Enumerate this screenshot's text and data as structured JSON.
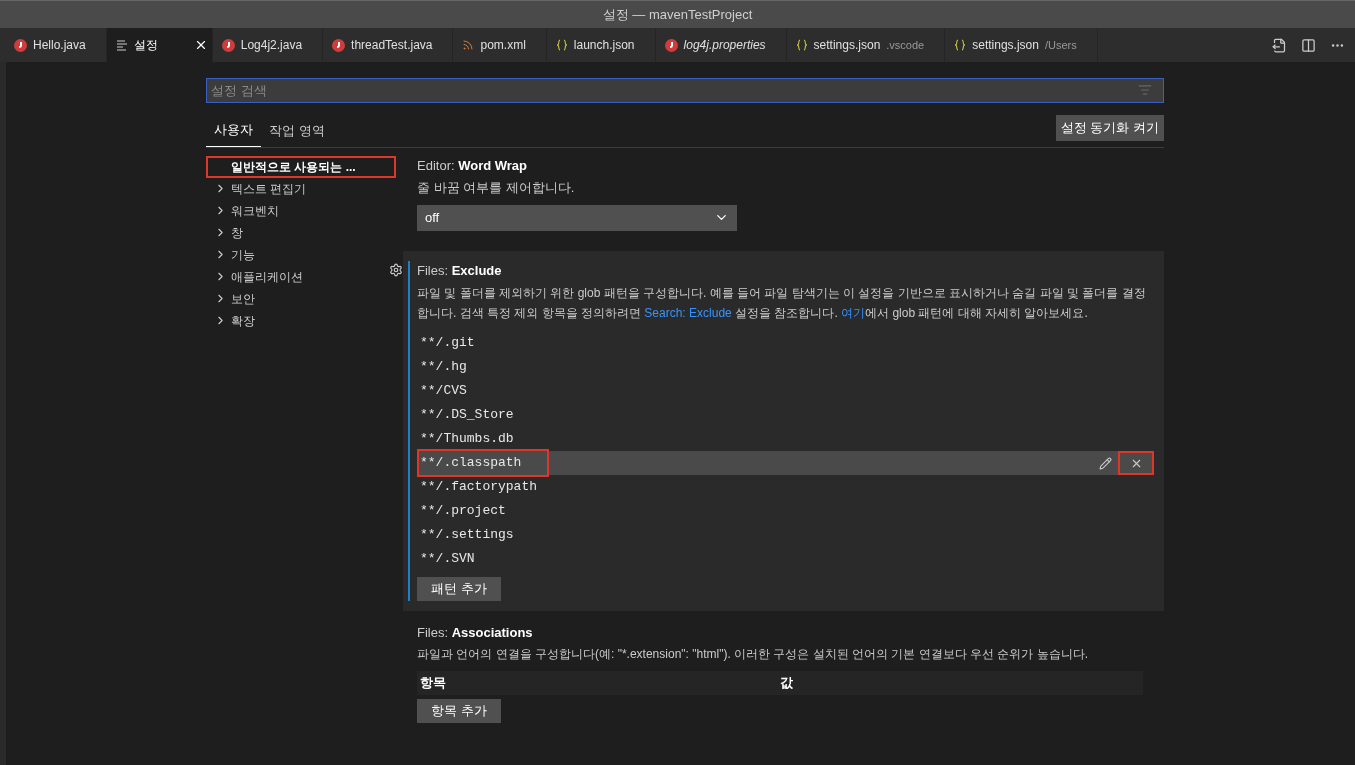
{
  "window": {
    "title": "설정 — mavenTestProject"
  },
  "editor_tabs": [
    {
      "label": "Hello.java",
      "kind": "java",
      "selected": false,
      "preview": false
    },
    {
      "label": "설정",
      "kind": "settings",
      "selected": true,
      "preview": false
    },
    {
      "label": "Log4j2.java",
      "kind": "java",
      "selected": false,
      "preview": false
    },
    {
      "label": "threadTest.java",
      "kind": "java",
      "selected": false,
      "preview": false
    },
    {
      "label": "pom.xml",
      "kind": "xml",
      "selected": false,
      "preview": false
    },
    {
      "label": "launch.json",
      "kind": "json",
      "selected": false,
      "preview": false
    },
    {
      "label": "log4j.properties",
      "kind": "java",
      "selected": false,
      "preview": true
    },
    {
      "label": "settings.json",
      "description": ".vscode",
      "kind": "json",
      "selected": false,
      "preview": false
    },
    {
      "label": "settings.json",
      "description": "/Users",
      "kind": "json",
      "selected": false,
      "preview": false
    }
  ],
  "search": {
    "placeholder": "설정 검색"
  },
  "scope_tabs": [
    {
      "label": "사용자",
      "selected": true
    },
    {
      "label": "작업 영역",
      "selected": false
    }
  ],
  "sync_button": "설정 동기화 켜기",
  "toc": [
    {
      "label": "일반적으로 사용되는 ...",
      "expandable": false,
      "selected": true,
      "highlighted": true
    },
    {
      "label": "텍스트 편집기",
      "expandable": true,
      "selected": false,
      "highlighted": false
    },
    {
      "label": "워크벤치",
      "expandable": true,
      "selected": false,
      "highlighted": false
    },
    {
      "label": "창",
      "expandable": true,
      "selected": false,
      "highlighted": false
    },
    {
      "label": "기능",
      "expandable": true,
      "selected": false,
      "highlighted": false
    },
    {
      "label": "애플리케이션",
      "expandable": true,
      "selected": false,
      "highlighted": false
    },
    {
      "label": "보안",
      "expandable": true,
      "selected": false,
      "highlighted": false
    },
    {
      "label": "확장",
      "expandable": true,
      "selected": false,
      "highlighted": false
    }
  ],
  "word_wrap": {
    "category": "Editor: ",
    "name": "Word Wrap",
    "description": "줄 바꿈 여부를 제어합니다.",
    "value": "off"
  },
  "exclude": {
    "category": "Files: ",
    "name": "Exclude",
    "description": [
      {
        "kind": "text",
        "text": "파일 및 폴더를 제외하기 위한 glob 패턴을 구성합니다. 예를 들어 파일 탐색기는 이 설정을 기반으로 표시하거나 숨길 파일 및 폴더를 결정합니다. 검색 특정 제외 항목을 정의하려면 "
      },
      {
        "kind": "link",
        "text": "Search: Exclude"
      },
      {
        "kind": "text",
        "text": " 설정을 참조합니다. "
      },
      {
        "kind": "link",
        "text": "여기"
      },
      {
        "kind": "text",
        "text": "에서 glob 패턴에 대해 자세히 알아보세요."
      }
    ],
    "patterns": [
      {
        "text": "**/.git",
        "selected": false,
        "highlighted": false
      },
      {
        "text": "**/.hg",
        "selected": false,
        "highlighted": false
      },
      {
        "text": "**/CVS",
        "selected": false,
        "highlighted": false
      },
      {
        "text": "**/.DS_Store",
        "selected": false,
        "highlighted": false
      },
      {
        "text": "**/Thumbs.db",
        "selected": false,
        "highlighted": false
      },
      {
        "text": "**/.classpath",
        "selected": true,
        "highlighted": true
      },
      {
        "text": "**/.factorypath",
        "selected": false,
        "highlighted": false
      },
      {
        "text": "**/.project",
        "selected": false,
        "highlighted": false
      },
      {
        "text": "**/.settings",
        "selected": false,
        "highlighted": false
      },
      {
        "text": "**/.SVN",
        "selected": false,
        "highlighted": false
      }
    ],
    "remove_button_highlighted": true,
    "add_button": "패턴 추가"
  },
  "associations": {
    "category": "Files: ",
    "name": "Associations",
    "description": "파일과 언어의 연결을 구성합니다(예: \"*.extension\": \"html\"). 이러한 구성은 설치된 언어의 기본 연결보다 우선 순위가 높습니다.",
    "columns": [
      "항목",
      "값"
    ],
    "add_button": "항목 추가"
  }
}
